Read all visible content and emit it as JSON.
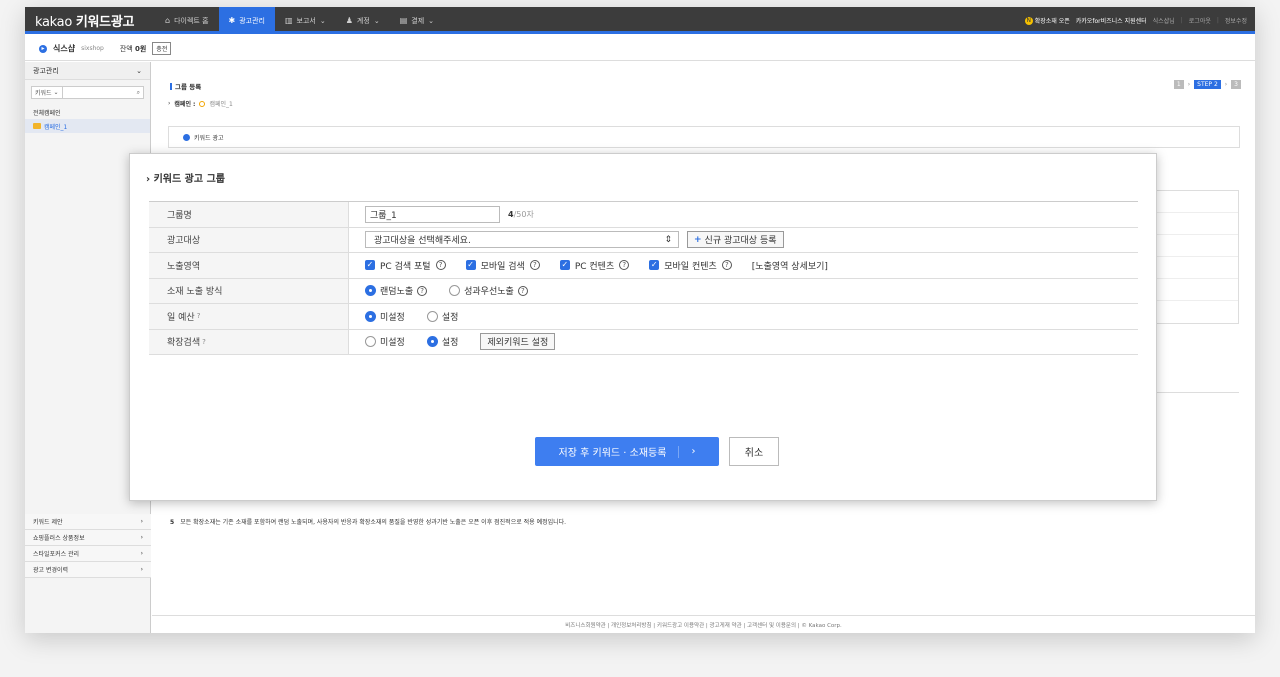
{
  "brand": {
    "name_light": "kakao",
    "name_bold": "키워드광고"
  },
  "topnav": {
    "items": [
      {
        "label": "다이렉트 홈",
        "icon": "home-icon",
        "caret": ""
      },
      {
        "label": "광고관리",
        "icon": "gear-icon",
        "caret": ""
      },
      {
        "label": "보고서",
        "icon": "chart-icon",
        "caret": "⌄"
      },
      {
        "label": "계정",
        "icon": "user-icon",
        "caret": "⌄"
      },
      {
        "label": "결제",
        "icon": "document-icon",
        "caret": "⌄"
      }
    ],
    "right": {
      "promo_icon": "N",
      "promo": "확장소재 오픈",
      "business_center": "카카오for비즈니스 지원센터",
      "user": "식스샵님",
      "logout": "로그아웃",
      "edit_info": "정보수정"
    }
  },
  "account": {
    "name": "식스샵",
    "id": "sixshop",
    "balance_label": "잔액",
    "balance": "0원",
    "charge": "충전"
  },
  "sidebar": {
    "title": "광고관리",
    "search_select": "키워드",
    "all_campaigns": "전체캠페인",
    "campaign": "캠페인_1",
    "bottom_items": [
      "키워드 제안",
      "쇼핑플러스 상품정보",
      "스타일포커스 관리",
      "광고 변경이력"
    ]
  },
  "main": {
    "section_title": "그룹 등록",
    "campaign_label": "캠페인 :",
    "campaign_name": "캠페인_1",
    "steps": [
      "1",
      "STEP 2",
      "3"
    ],
    "keyword_ad": "키워드 광고",
    "note_number": "5",
    "note_text": "모든 확장소재는 기존 소재를 포함하여 랜덤 노출되며, 사용자의 반응과 확장소재의 품질을 반영한 성과기반 노출은 오픈 이후 점진적으로 적용 예정입니다.",
    "footer": "비즈니스회원약관 | 개인정보처리방침 | 키워드광고 이용약관 | 광고게재 약관 | 고객센터 및 이용문의 | © Kakao Corp."
  },
  "modal": {
    "title": "› 키워드 광고 그룹",
    "group_name_label": "그룹명",
    "group_name_value": "그룹_1",
    "group_name_count": "4",
    "group_name_max": "/50자",
    "target_label": "광고대상",
    "target_placeholder": "광고대상을 선택해주세요.",
    "new_target": "신규 광고대상 등록",
    "exposure_label": "노출영역",
    "exposure_options": [
      "PC 검색 포털",
      "모바일 검색",
      "PC 컨텐츠",
      "모바일 컨텐츠"
    ],
    "exposure_detail": "[노출영역 상세보기]",
    "method_label": "소재 노출 방식",
    "method_options": [
      "랜덤노출",
      "성과우선노출"
    ],
    "budget_label": "일 예산",
    "budget_options": [
      "미설정",
      "설정"
    ],
    "ext_label": "확장검색",
    "ext_options": [
      "미설정",
      "설정"
    ],
    "ext_exclude": "제외키워드 설정",
    "save": "저장 후 키워드 · 소재등록",
    "cancel": "취소"
  }
}
